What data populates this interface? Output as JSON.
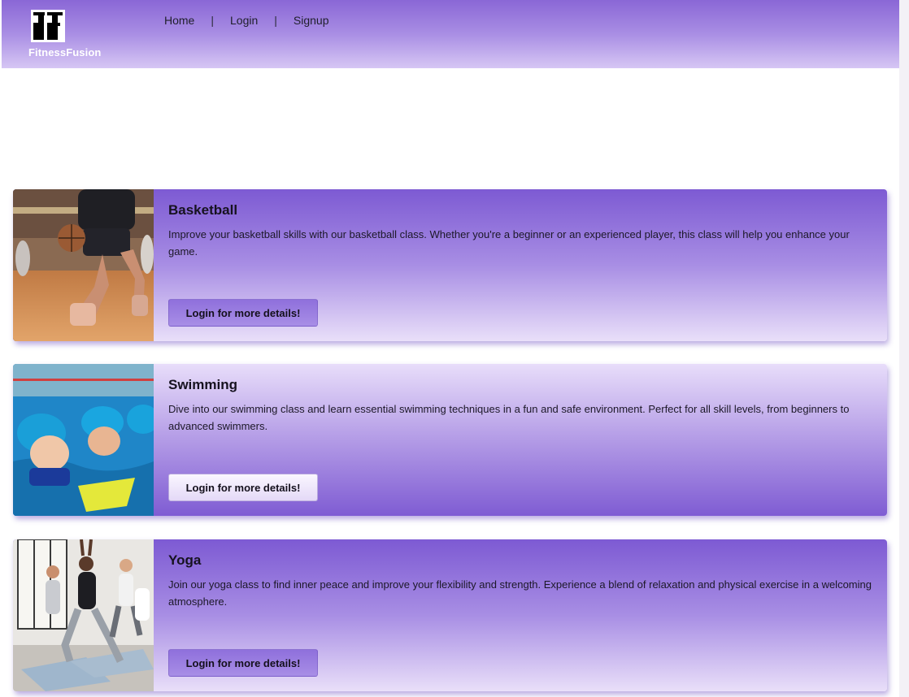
{
  "brand": {
    "name": "FitnessFusion"
  },
  "nav": {
    "home": "Home",
    "separator": "|",
    "login": "Login",
    "signup": "Signup"
  },
  "classes": [
    {
      "title": "Basketball",
      "description": "Improve your basketball skills with our basketball class. Whether you're a beginner or an experienced player, this class will help you enhance your game.",
      "button": "Login for more details!"
    },
    {
      "title": "Swimming",
      "description": "Dive into our swimming class and learn essential swimming techniques in a fun and safe environment. Perfect for all skill levels, from beginners to advanced swimmers.",
      "button": "Login for more details!"
    },
    {
      "title": "Yoga",
      "description": "Join our yoga class to find inner peace and improve your flexibility and strength. Experience a blend of relaxation and physical exercise in a welcoming atmosphere.",
      "button": "Login for more details!"
    }
  ],
  "colors": {
    "header_top": "#8a67d6",
    "header_bottom": "#d6c6f4",
    "card_dark": "#7d5ad3",
    "card_light": "#e8ddfa"
  }
}
